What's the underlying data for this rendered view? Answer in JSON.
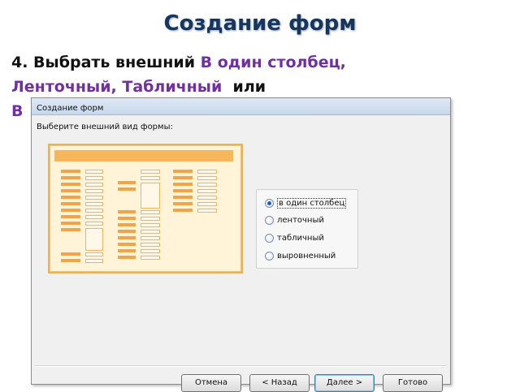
{
  "slide": {
    "title": "Создание форм",
    "step_prefix": "4. Выбрать внешний ",
    "highlight_1": "В один столбец,",
    "highlight_2": "Ленточный, Табличный",
    "or_word": "  или",
    "line3_start": "В"
  },
  "dialog": {
    "title": "Создание форм",
    "prompt": "Выберите внешний вид формы:",
    "options": [
      {
        "label": "в один столбец",
        "selected": true
      },
      {
        "label": "ленточный",
        "selected": false
      },
      {
        "label": "табличный",
        "selected": false
      },
      {
        "label": "выровненный",
        "selected": false
      }
    ],
    "buttons": {
      "cancel": "Отмена",
      "back": "< Назад",
      "next": "Далее >",
      "finish": "Готово"
    }
  },
  "colors": {
    "title": "#17365d",
    "highlight": "#7030a0",
    "preview_accent": "#f5a348"
  }
}
